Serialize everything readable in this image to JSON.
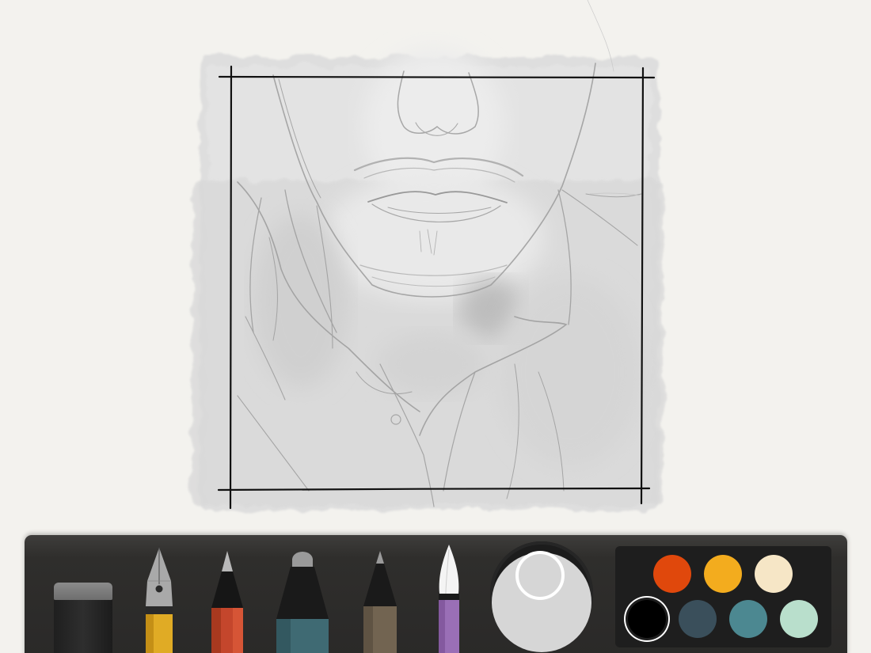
{
  "app": {
    "background": "#f3f2ee"
  },
  "canvas": {
    "artwork": "pencil-and-wash-sketch",
    "frame_color": "#111111"
  },
  "toolbar": {
    "tools": [
      {
        "name": "eraser",
        "icon": "eraser-icon",
        "color": "#2a2a2a"
      },
      {
        "name": "fountain-pen",
        "icon": "fountain-pen-icon",
        "color": "#e0ab25"
      },
      {
        "name": "pencil",
        "icon": "pencil-icon",
        "color": "#c4462c"
      },
      {
        "name": "marker",
        "icon": "marker-icon",
        "color": "#3f6a73"
      },
      {
        "name": "fine-pen",
        "icon": "fine-pen-icon",
        "color": "#726451"
      },
      {
        "name": "brush",
        "icon": "brush-icon",
        "color": "#9a6fb6"
      }
    ],
    "mixer": {
      "icon": "color-mixer-icon",
      "current_color": "#d6d6d6"
    },
    "palette": {
      "swatches": [
        "#e0480c",
        "#f3ac1e",
        "#f6e6c6",
        "#000000",
        "#3a4f5b",
        "#4c8891",
        "#b9dfcc"
      ],
      "selected_index": 3
    }
  }
}
